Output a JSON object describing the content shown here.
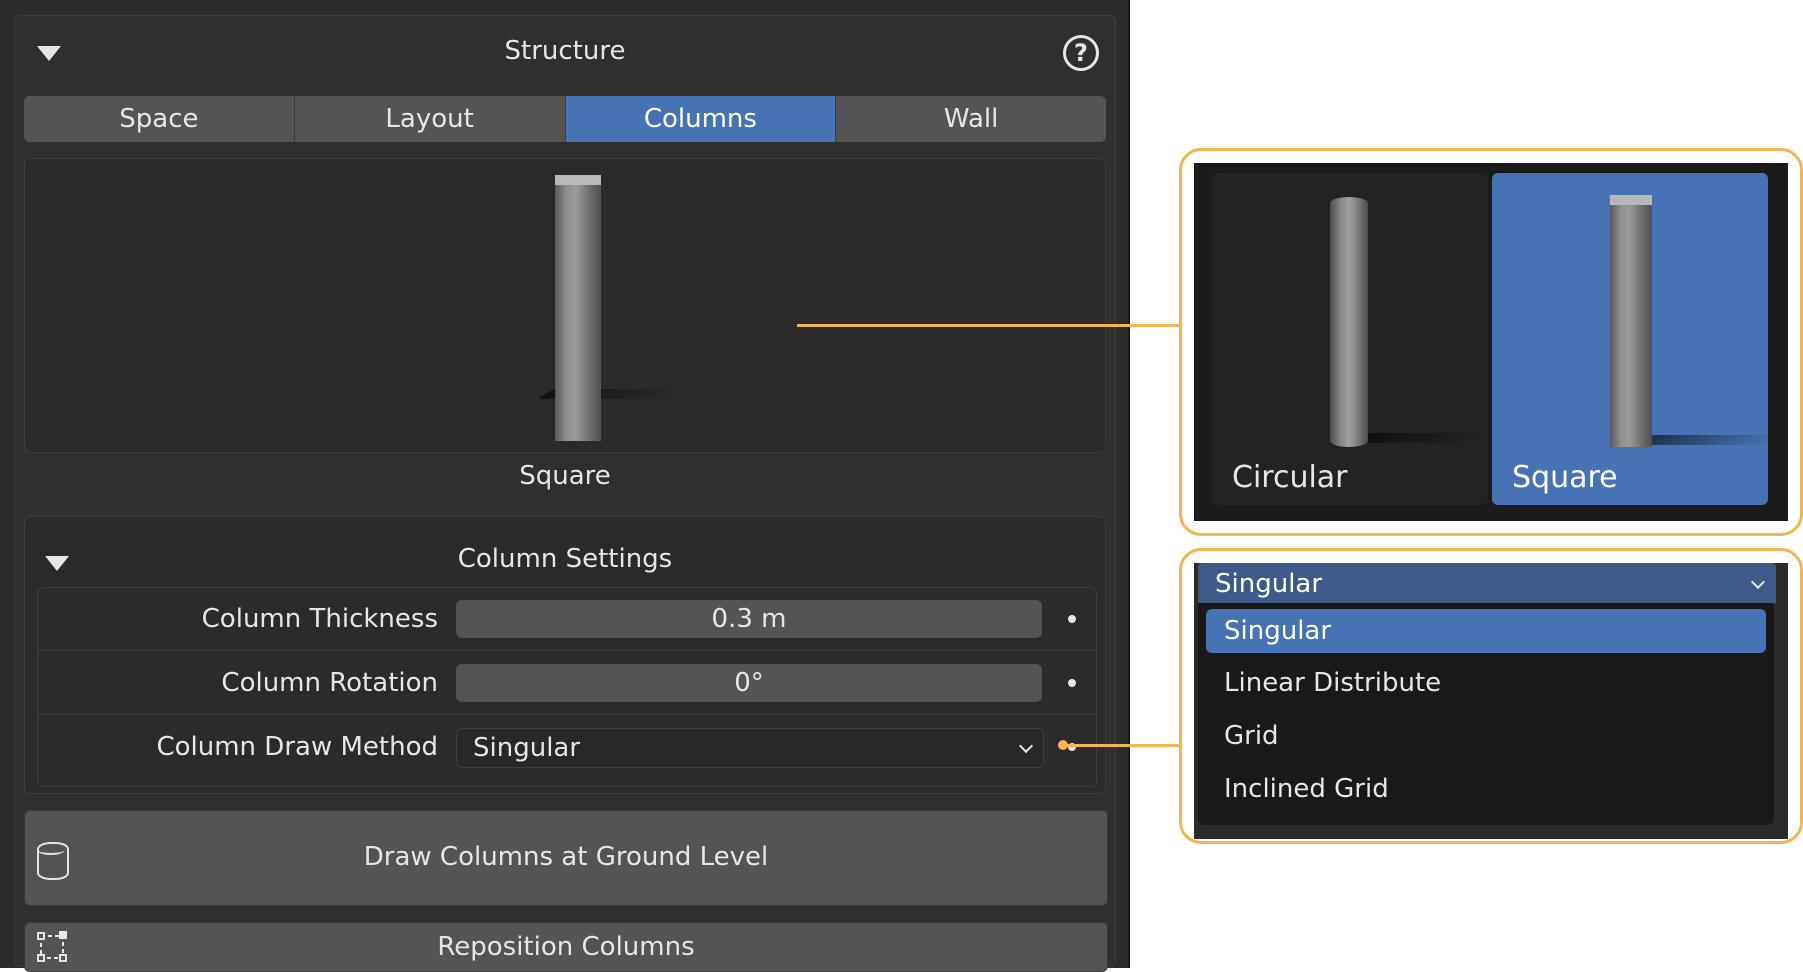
{
  "panel": {
    "title": "Structure",
    "help_icon": "question-circle-icon",
    "tabs": [
      {
        "label": "Space",
        "active": false
      },
      {
        "label": "Layout",
        "active": false
      },
      {
        "label": "Columns",
        "active": true
      },
      {
        "label": "Wall",
        "active": false
      }
    ],
    "preview_caption": "Square",
    "settings": {
      "title": "Column Settings",
      "rows": [
        {
          "label": "Column Thickness",
          "value": "0.3 m"
        },
        {
          "label": "Column Rotation",
          "value": "0°"
        },
        {
          "label": "Column Draw Method",
          "value": "Singular"
        }
      ]
    },
    "buttons": {
      "draw_ground": "Draw Columns at Ground Level",
      "reposition": "Reposition Columns"
    }
  },
  "callout_shapes": {
    "options": [
      {
        "label": "Circular",
        "selected": false
      },
      {
        "label": "Square",
        "selected": true
      }
    ]
  },
  "callout_dropdown": {
    "current": "Singular",
    "items": [
      {
        "label": "Singular",
        "selected": true
      },
      {
        "label": "Linear Distribute",
        "selected": false
      },
      {
        "label": "Grid",
        "selected": false
      },
      {
        "label": "Inclined Grid",
        "selected": false
      }
    ]
  },
  "colors": {
    "accent": "#4772b3",
    "callout": "#f5b450",
    "panel_bg": "#2f2f2f"
  }
}
